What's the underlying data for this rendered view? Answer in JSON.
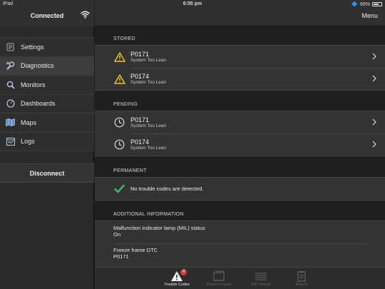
{
  "status_bar": {
    "device": "iPad",
    "time": "6:55 pm",
    "battery": "66%",
    "battery_level": 0.66
  },
  "sidebar": {
    "title": "Connected",
    "items": [
      {
        "label": "Settings",
        "icon": "settings-icon"
      },
      {
        "label": "Diagnostics",
        "icon": "wrench-icon",
        "active": true
      },
      {
        "label": "Monitors",
        "icon": "magnifier-icon"
      },
      {
        "label": "Dashboards",
        "icon": "gauge-icon"
      },
      {
        "label": "Maps",
        "icon": "map-icon"
      },
      {
        "label": "Logs",
        "icon": "logs-icon"
      }
    ],
    "disconnect_label": "Disconnect"
  },
  "header": {
    "menu_label": "Menu"
  },
  "stored": {
    "label": "STORED",
    "items": [
      {
        "code": "P0171",
        "desc": "System Too Lean"
      },
      {
        "code": "P0174",
        "desc": "System Too Lean"
      }
    ]
  },
  "pending": {
    "label": "PENDING",
    "items": [
      {
        "code": "P0171",
        "desc": "System Too Lean"
      },
      {
        "code": "P0174",
        "desc": "System Too Lean"
      }
    ]
  },
  "permanent": {
    "label": "PERMANENT",
    "message": "No trouble codes are detected."
  },
  "additional": {
    "label": "ADDITIONAL INFORMATION",
    "items": [
      {
        "label": "Malfunction indicator lamp (MIL) status",
        "value": "On"
      },
      {
        "label": "Freeze frame DTC",
        "value": "P0171"
      }
    ]
  },
  "tabs": [
    {
      "label": "Trouble Codes",
      "badge": "4",
      "active": true
    },
    {
      "label": "Freeze Frame"
    },
    {
      "label": "PID Values"
    },
    {
      "label": "Report"
    }
  ],
  "colors": {
    "warning": "#e8c618",
    "check": "#3cb371",
    "badge": "#d83a2e"
  }
}
